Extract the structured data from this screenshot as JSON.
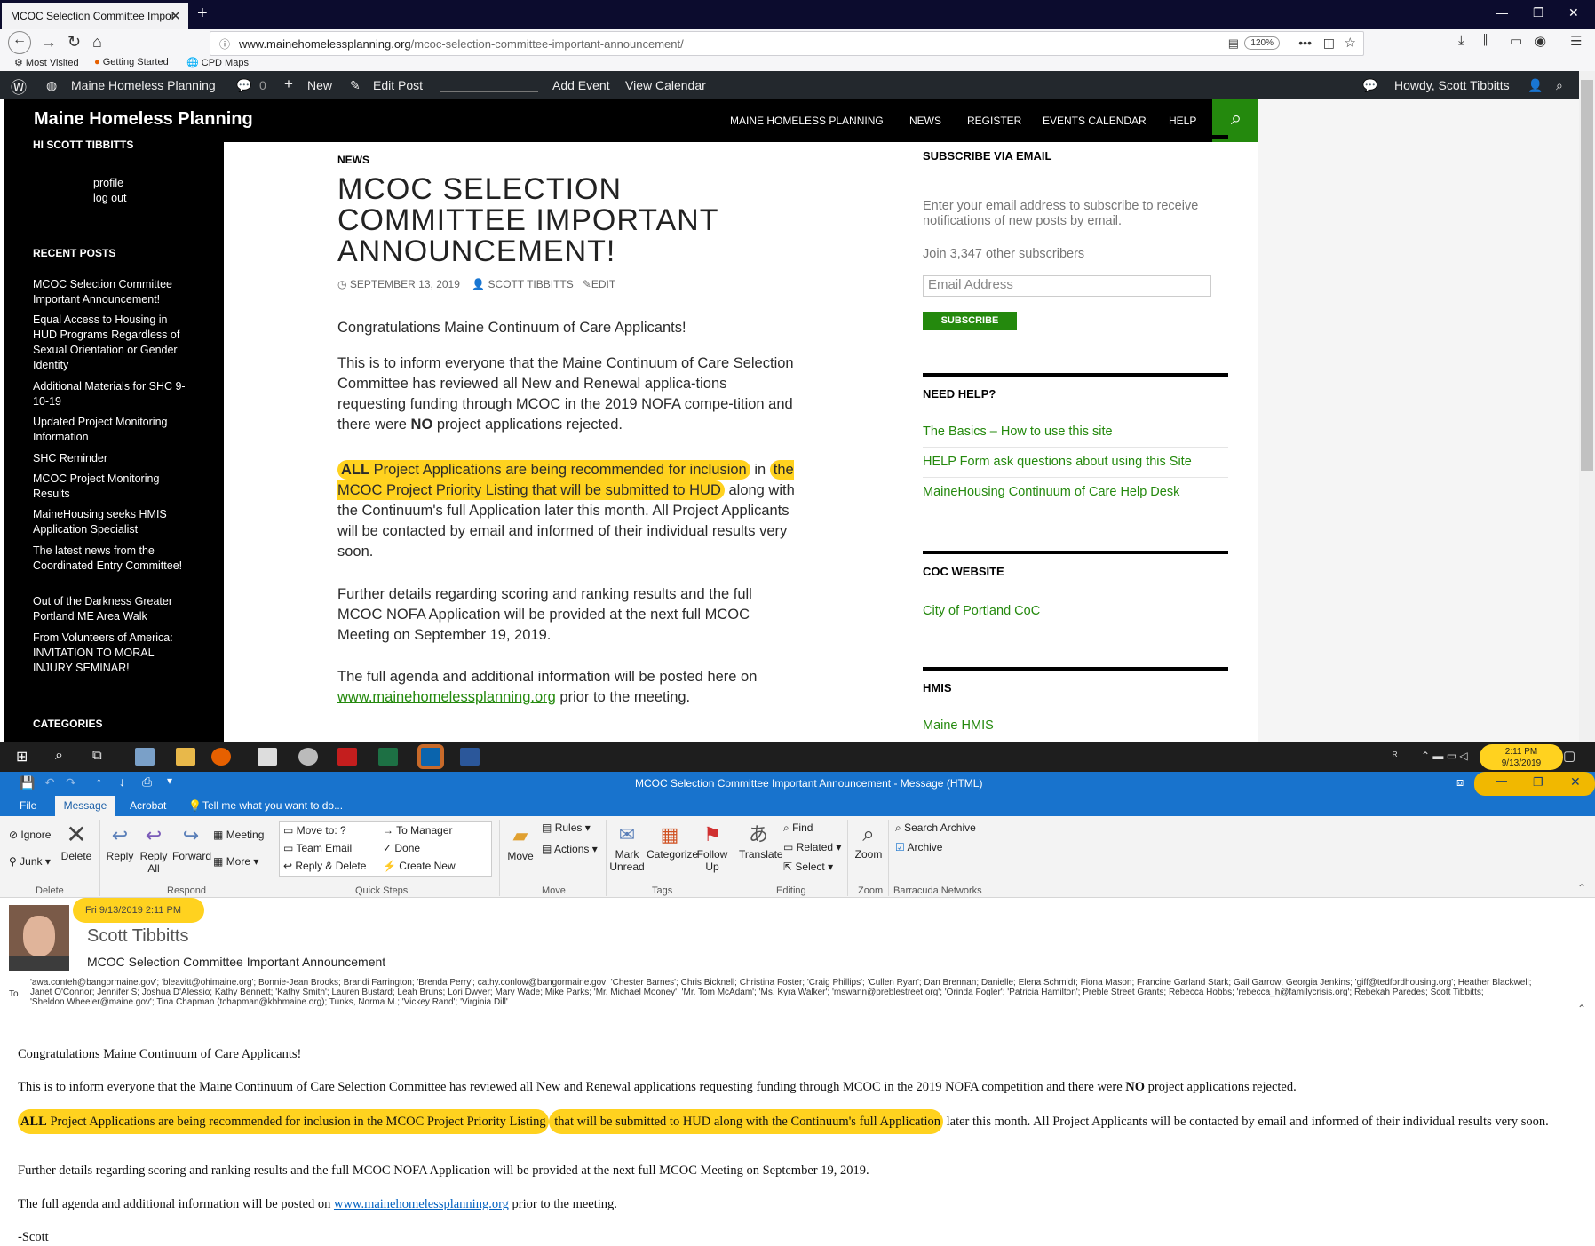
{
  "browser": {
    "tab_title": "MCOC Selection Committee Impor",
    "url_domain": "www.mainehomelessplanning.org",
    "url_path": "/mcoc-selection-committee-important-announcement/",
    "zoom": "120%",
    "bookmarks": [
      "Most Visited",
      "Getting Started",
      "CPD Maps"
    ]
  },
  "wp_admin": {
    "site": "Maine Homeless Planning",
    "comments": "0",
    "new": "New",
    "edit_post": "Edit Post",
    "add_event": "Add Event",
    "view_calendar": "View Calendar",
    "howdy": "Howdy, Scott Tibbitts"
  },
  "site": {
    "title": "Maine Homeless Planning",
    "nav": [
      "MAINE HOMELESS PLANNING",
      "NEWS",
      "REGISTER",
      "EVENTS CALENDAR",
      "HELP"
    ]
  },
  "sidebar": {
    "greeting": "HI SCOTT TIBBITTS",
    "profile": "profile",
    "logout": "log out",
    "recent_heading": "RECENT POSTS",
    "recent_posts": [
      "MCOC Selection Committee Important Announcement!",
      "Equal Access to Housing in HUD Programs Regardless of Sexual Orientation or Gender Identity",
      "Additional Materials for SHC 9-10-19",
      "Updated Project Monitoring Information",
      "SHC Reminder",
      "MCOC Project Monitoring Results",
      "MaineHousing seeks HMIS Application Specialist",
      "The latest news from the Coordinated Entry Committee!",
      "Out of the Darkness Greater Portland ME Area Walk",
      "From Volunteers of America: INVITATION TO MORAL INJURY SEMINAR!"
    ],
    "categories_heading": "CATEGORIES"
  },
  "post": {
    "category": "NEWS",
    "title": "MCOC SELECTION COMMITTEE IMPORTANT ANNOUNCEMENT!",
    "date": "SEPTEMBER 13, 2019",
    "author": "SCOTT TIBBITTS",
    "edit": "EDIT",
    "p1": "Congratulations Maine Continuum of Care Applicants!",
    "p2a": "This is to inform everyone that the Maine Continuum of Care Selection Committee has reviewed all New and Renewal applica-tions requesting funding through MCOC in the 2019 NOFA compe-tition and there were ",
    "p2_no": "NO",
    "p2b": " project applications rejected.",
    "p3_all": "ALL",
    "p3_hl1": " Project Applications are being recommended for inclusion",
    "p3_mid": " in",
    "p3_hl2": "the MCOC Project Priority Listing that will be submitted to HUD",
    "p3_rest": " along with the Continuum's full Application later this month. All Project Applicants will be contacted by email and informed of their individual results very soon.",
    "p4": "Further details regarding scoring and ranking results and the full MCOC NOFA Application will be provided at the next full MCOC Meeting on September 19, 2019.",
    "p5a": "The full agenda and additional information will be posted here on ",
    "p5_link": "www.mainehomelessplanning.org",
    "p5b": " prior to the meeting."
  },
  "widgets": {
    "subscribe_heading": "SUBSCRIBE VIA EMAIL",
    "subscribe_text": "Enter your email address to subscribe to receive notifications of new posts by email.",
    "subscribers": "Join 3,347 other subscribers",
    "email_placeholder": "Email Address",
    "subscribe_button": "SUBSCRIBE",
    "help_heading": "NEED HELP?",
    "help_links": [
      "The Basics – How to use this site",
      "HELP Form ask questions about using this Site",
      "MaineHousing Continuum of Care Help Desk"
    ],
    "coc_heading": "COC WEBSITE",
    "coc_link": "City of Portland CoC",
    "hmis_heading": "HMIS",
    "hmis_link": "Maine HMIS"
  },
  "taskbar": {
    "time": "2:11 PM",
    "date": "9/13/2019"
  },
  "outlook": {
    "window_title": "MCOC Selection Committee Important Announcement - Message (HTML)",
    "tabs": [
      "File",
      "Message",
      "Acrobat",
      "Tell me what you want to do..."
    ],
    "ribbon": {
      "ignore": "Ignore",
      "junk": "Junk",
      "delete": "Delete",
      "reply": "Reply",
      "reply_all": "Reply All",
      "forward": "Forward",
      "meeting": "Meeting",
      "more": "More",
      "qs_move_to": "Move to: ?",
      "qs_team_email": "Team Email",
      "qs_reply_delete": "Reply & Delete",
      "qs_to_manager": "To Manager",
      "qs_done": "Done",
      "qs_create_new": "Create New",
      "move": "Move",
      "rules": "Rules",
      "actions": "Actions",
      "mark_unread": "Mark Unread",
      "categorize": "Categorize",
      "follow_up": "Follow Up",
      "translate": "Translate",
      "find": "Find",
      "related": "Related",
      "select": "Select",
      "zoom": "Zoom",
      "search_archive": "Search Archive",
      "archive": "Archive",
      "groups": [
        "Delete",
        "Respond",
        "Quick Steps",
        "Move",
        "Tags",
        "Editing",
        "Zoom",
        "Barracuda Networks"
      ]
    },
    "message": {
      "date": "Fri 9/13/2019 2:11 PM",
      "sender": "Scott Tibbitts",
      "subject": "MCOC Selection Committee Important Announcement",
      "to_label": "To",
      "recipients": "'awa.conteh@bangormaine.gov'; 'bleavitt@ohimaine.org'; Bonnie-Jean Brooks; Brandi Farrington; 'Brenda Perry'; cathy.conlow@bangormaine.gov; 'Chester Barnes'; Chris Bicknell; Christina Foster; 'Craig Phillips'; 'Cullen Ryan'; Dan Brennan; Danielle; Elena Schmidt; Fiona Mason; Francine Garland Stark; Gail Garrow; Georgia Jenkins; 'giff@tedfordhousing.org'; Heather Blackwell; Janet O'Connor; Jennifer S; Joshua D'Alessio; Kathy Bennett; 'Kathy Smith'; Lauren Bustard; Leah Bruns; Lori Dwyer; Mary Wade; Mike Parks; 'Mr. Michael Mooney'; 'Mr. Tom McAdam'; 'Ms. Kyra Walker'; 'mswann@preblestreet.org'; 'Orinda Fogler'; 'Patricia Hamilton'; Preble Street Grants; Rebecca Hobbs; 'rebecca_h@familycrisis.org'; Rebekah Paredes; Scott Tibbitts; 'Sheldon.Wheeler@maine.gov'; Tina Chapman (tchapman@kbhmaine.org); Tunks, Norma M.; 'Vickey Rand'; 'Virginia Dill'",
      "p1": "Congratulations Maine Continuum of Care Applicants!",
      "p2a": "This is to inform everyone that the Maine Continuum of Care Selection Committee has reviewed all New and Renewal applications requesting funding through MCOC in the 2019 NOFA competition and there were ",
      "p2_no": "NO",
      "p2b": " project applications rejected.",
      "p3_all": "ALL",
      "p3_hl1": " Project Applications are being recommended for inclusion in the MCOC Project Priority Listing",
      "p3_hl2": " that will be submitted to HUD along with the Continuum's full Application",
      "p3_rest": " later this month. All Project Applicants will be contacted by email and informed of their individual results very soon.",
      "p4": "Further details regarding scoring and ranking results and the full MCOC NOFA Application will be provided at the next full MCOC Meeting on September 19, 2019.",
      "p5a": "The full agenda and additional information will be posted on ",
      "p5_link": "www.mainehomelessplanning.org",
      "p5b": " prior to the meeting.",
      "signoff": "-Scott"
    }
  },
  "colors": {
    "wp_green": "#24890d",
    "highlight": "#ffd21f",
    "outlook_blue": "#1873cd"
  }
}
